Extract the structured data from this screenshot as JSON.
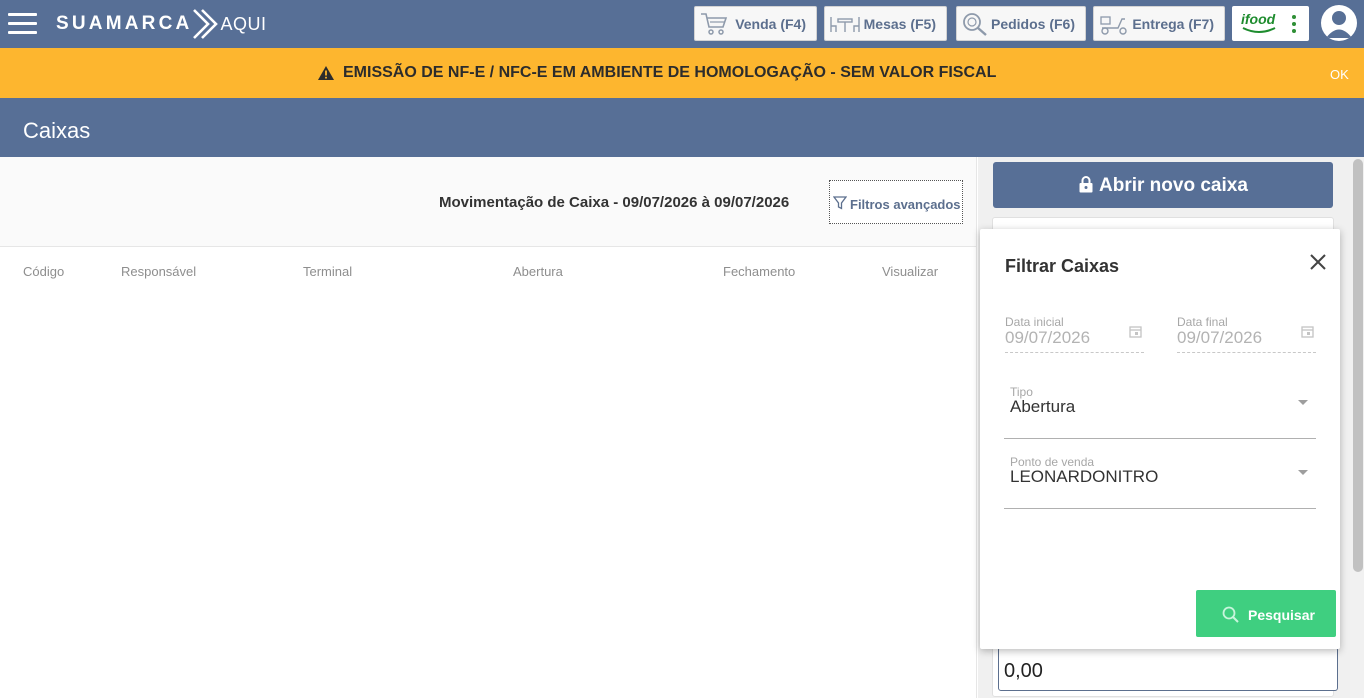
{
  "app": {
    "brand": "SUAMARCA",
    "brand_suffix": "AQUI"
  },
  "nav": {
    "buttons": [
      {
        "label": "Venda (F4)",
        "icon": "cart-icon"
      },
      {
        "label": "Mesas (F5)",
        "icon": "tables-icon"
      },
      {
        "label": "Pedidos (F6)",
        "icon": "search-orders-icon"
      },
      {
        "label": "Entrega (F7)",
        "icon": "scooter-icon"
      }
    ],
    "ifood_label": "ifood"
  },
  "warning": {
    "message": "EMISSÃO DE NF-E / NFC-E EM AMBIENTE DE HOMOLOGAÇÃO - SEM VALOR FISCAL",
    "dismiss": "OK"
  },
  "page": {
    "title": "Caixas"
  },
  "movement": {
    "title": "Movimentação de Caixa - 09/07/2026 à 09/07/2026",
    "advanced_filters": "Filtros avançados"
  },
  "table": {
    "columns": [
      "Código",
      "Responsável",
      "Terminal",
      "Abertura",
      "Fechamento",
      "Visualizar"
    ]
  },
  "right": {
    "open_cash": "Abrir novo caixa",
    "value": "0,00"
  },
  "filter_popup": {
    "title": "Filtrar Caixas",
    "start_date_label": "Data inicial",
    "start_date": "09/07/2026",
    "end_date_label": "Data final",
    "end_date": "09/07/2026",
    "type_label": "Tipo",
    "type_value": "Abertura",
    "pos_label": "Ponto de venda",
    "pos_value": "LEONARDONITRO",
    "search": "Pesquisar"
  },
  "colors": {
    "header": "#576f96",
    "warning": "#fdb62f",
    "search_button": "#3fcf80",
    "ifood": "#1e8c2e"
  }
}
